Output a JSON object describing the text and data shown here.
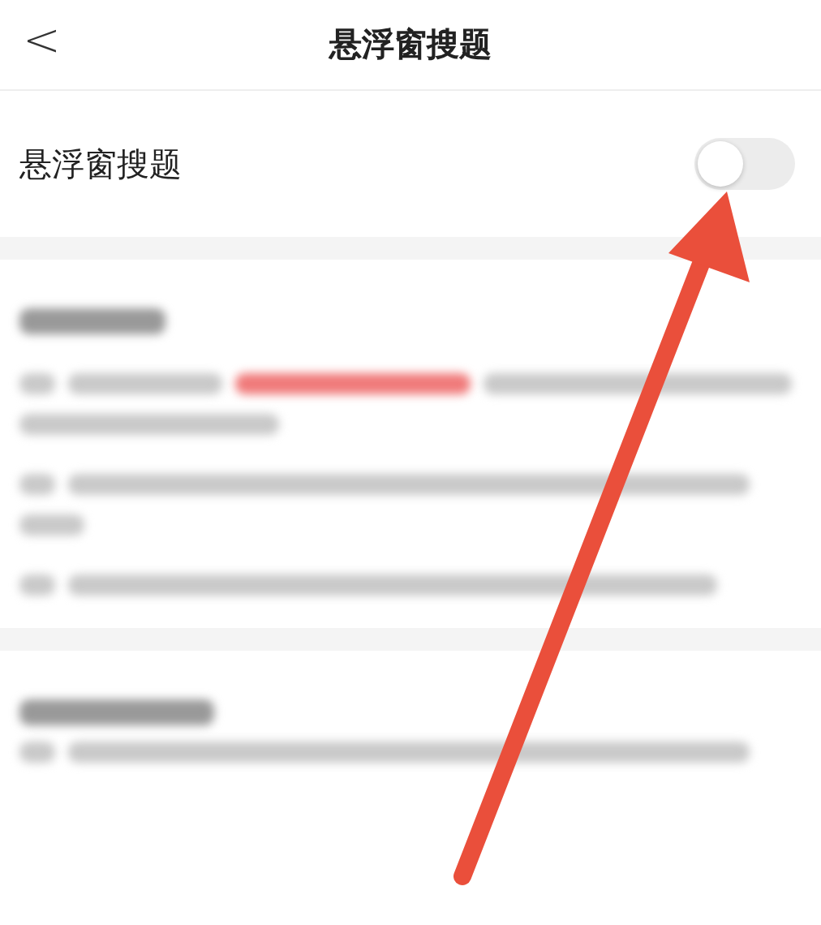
{
  "header": {
    "back_icon": "<",
    "title": "悬浮窗搜题"
  },
  "setting": {
    "label": "悬浮窗搜题",
    "on": false
  }
}
